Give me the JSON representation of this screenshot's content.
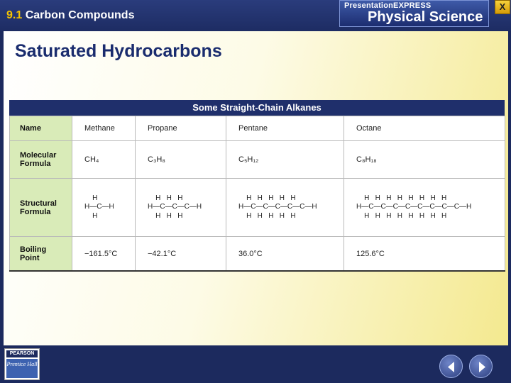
{
  "header": {
    "section_number": "9.1",
    "section_title": "Carbon Compounds",
    "logo_top": "PresentationEXPRESS",
    "logo_main": "Physical Science",
    "close_label": "X"
  },
  "slide": {
    "title": "Saturated Hydrocarbons",
    "table": {
      "caption": "Some Straight-Chain Alkanes",
      "rows": {
        "name": {
          "label": "Name",
          "values": [
            "Methane",
            "Propane",
            "Pentane",
            "Octane"
          ]
        },
        "molecular_formula": {
          "label": "Molecular\nFormula",
          "values": [
            "CH₄",
            "C₃H₈",
            "C₅H₁₂",
            "C₈H₁₈"
          ]
        },
        "structural_formula": {
          "label": "Structural\nFormula",
          "values": [
            "    H\nH—C—H\n    H",
            "    H   H   H\nH—C—C—C—H\n    H   H   H",
            "    H   H   H   H   H\nH—C—C—C—C—C—H\n    H   H   H   H   H",
            "    H   H   H   H   H   H   H   H\nH—C—C—C—C—C—C—C—C—H\n    H   H   H   H   H   H   H   H"
          ]
        },
        "boiling_point": {
          "label": "Boiling\nPoint",
          "values": [
            "−161.5°C",
            "−42.1°C",
            "36.0°C",
            "125.6°C"
          ]
        }
      }
    }
  },
  "footer": {
    "publisher_top": "PEARSON",
    "publisher_main": "Prentice Hall"
  },
  "colors": {
    "accent": "#f6c400",
    "navy": "#1c2a5e",
    "label_bg": "#d9ebb8"
  }
}
